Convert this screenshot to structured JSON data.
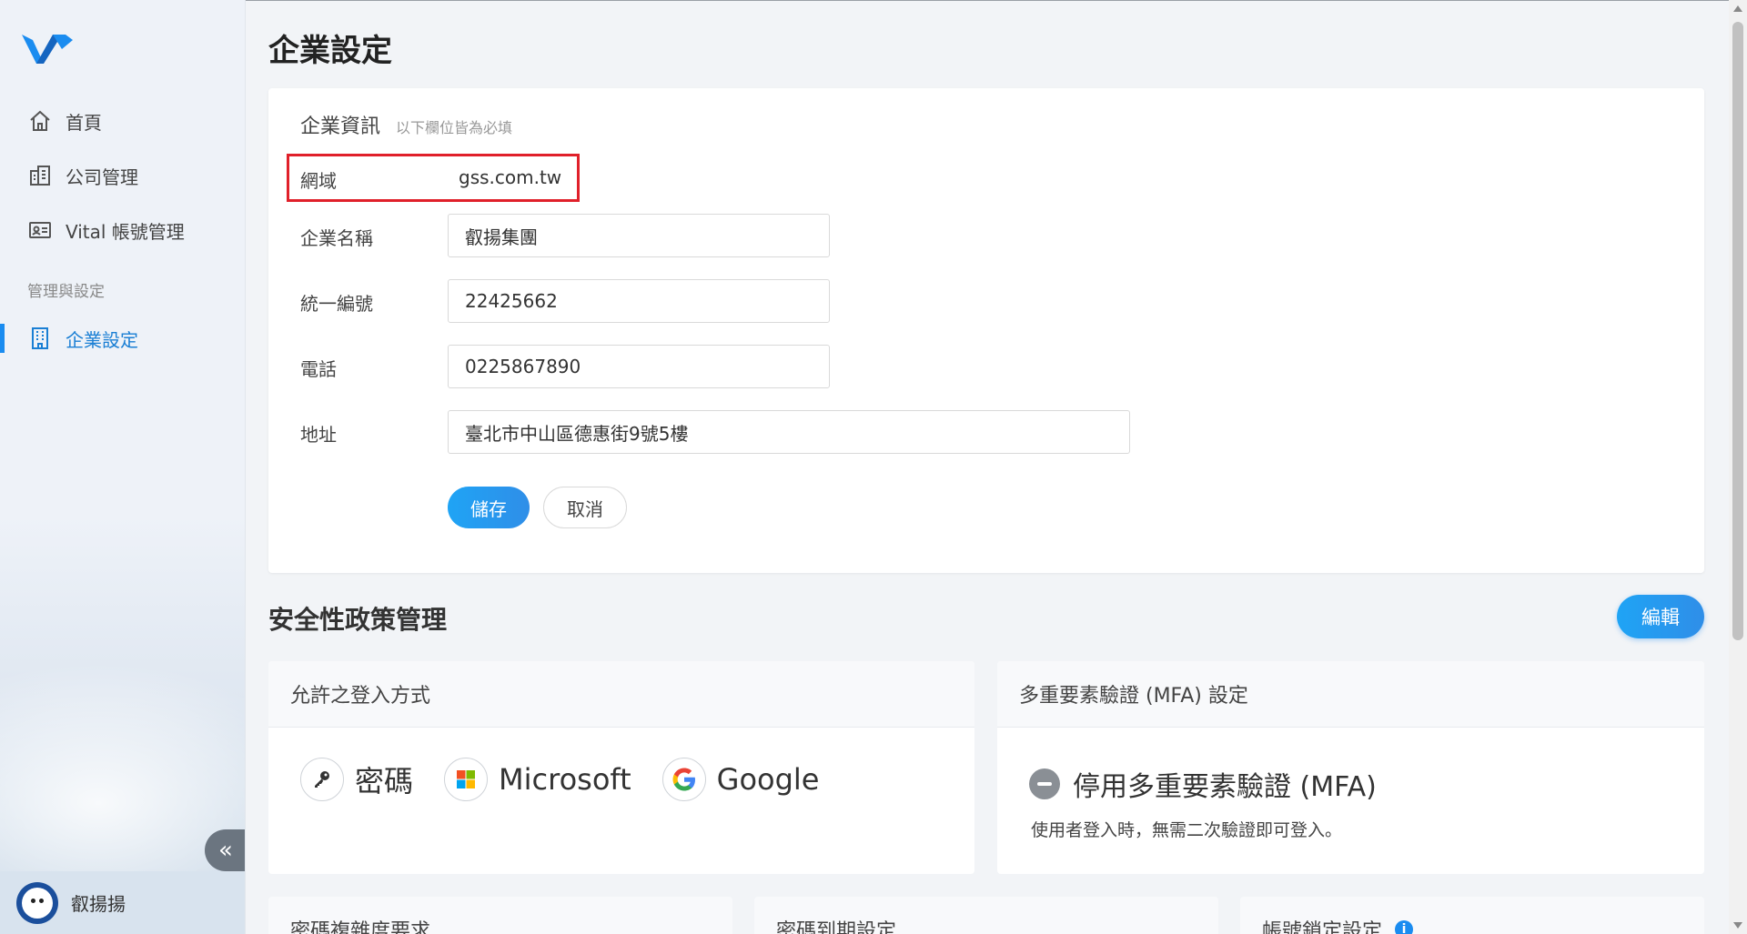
{
  "sidebar": {
    "items": [
      {
        "label": "首頁",
        "icon": "home-icon"
      },
      {
        "label": "公司管理",
        "icon": "building-icon"
      },
      {
        "label": "Vital 帳號管理",
        "icon": "id-card-icon"
      }
    ],
    "section_label": "管理與設定",
    "active_item": {
      "label": "企業設定",
      "icon": "office-icon"
    },
    "collapse_glyph": "«",
    "user_name": "叡揚揚"
  },
  "page": {
    "title": "企業設定"
  },
  "company_info": {
    "heading": "企業資訊",
    "subheading": "以下欄位皆為必填",
    "domain_label": "網域",
    "domain_value": "gss.com.tw",
    "name_label": "企業名稱",
    "name_value": "叡揚集團",
    "tax_id_label": "統一編號",
    "tax_id_value": "22425662",
    "phone_label": "電話",
    "phone_value": "0225867890",
    "address_label": "地址",
    "address_value": "臺北市中山區德惠街9號5樓",
    "save_label": "儲存",
    "cancel_label": "取消"
  },
  "security": {
    "title": "安全性政策管理",
    "edit_label": "編輯",
    "login_panel": {
      "title": "允許之登入方式",
      "methods": [
        {
          "label": "密碼",
          "icon": "key-icon"
        },
        {
          "label": "Microsoft",
          "icon": "microsoft-icon"
        },
        {
          "label": "Google",
          "icon": "google-icon"
        }
      ]
    },
    "mfa_panel": {
      "title": "多重要素驗證 (MFA) 設定",
      "status": "停用多重要素驗證 (MFA)",
      "description": "使用者登入時，無需二次驗證即可登入。"
    },
    "bottom_panels": [
      {
        "title": "密碼複雜度要求"
      },
      {
        "title": "密碼到期設定"
      },
      {
        "title": "帳號鎖定設定",
        "info_glyph": "i"
      }
    ]
  },
  "colors": {
    "accent": "#1a8cf0",
    "highlight_border": "#e0202a"
  }
}
